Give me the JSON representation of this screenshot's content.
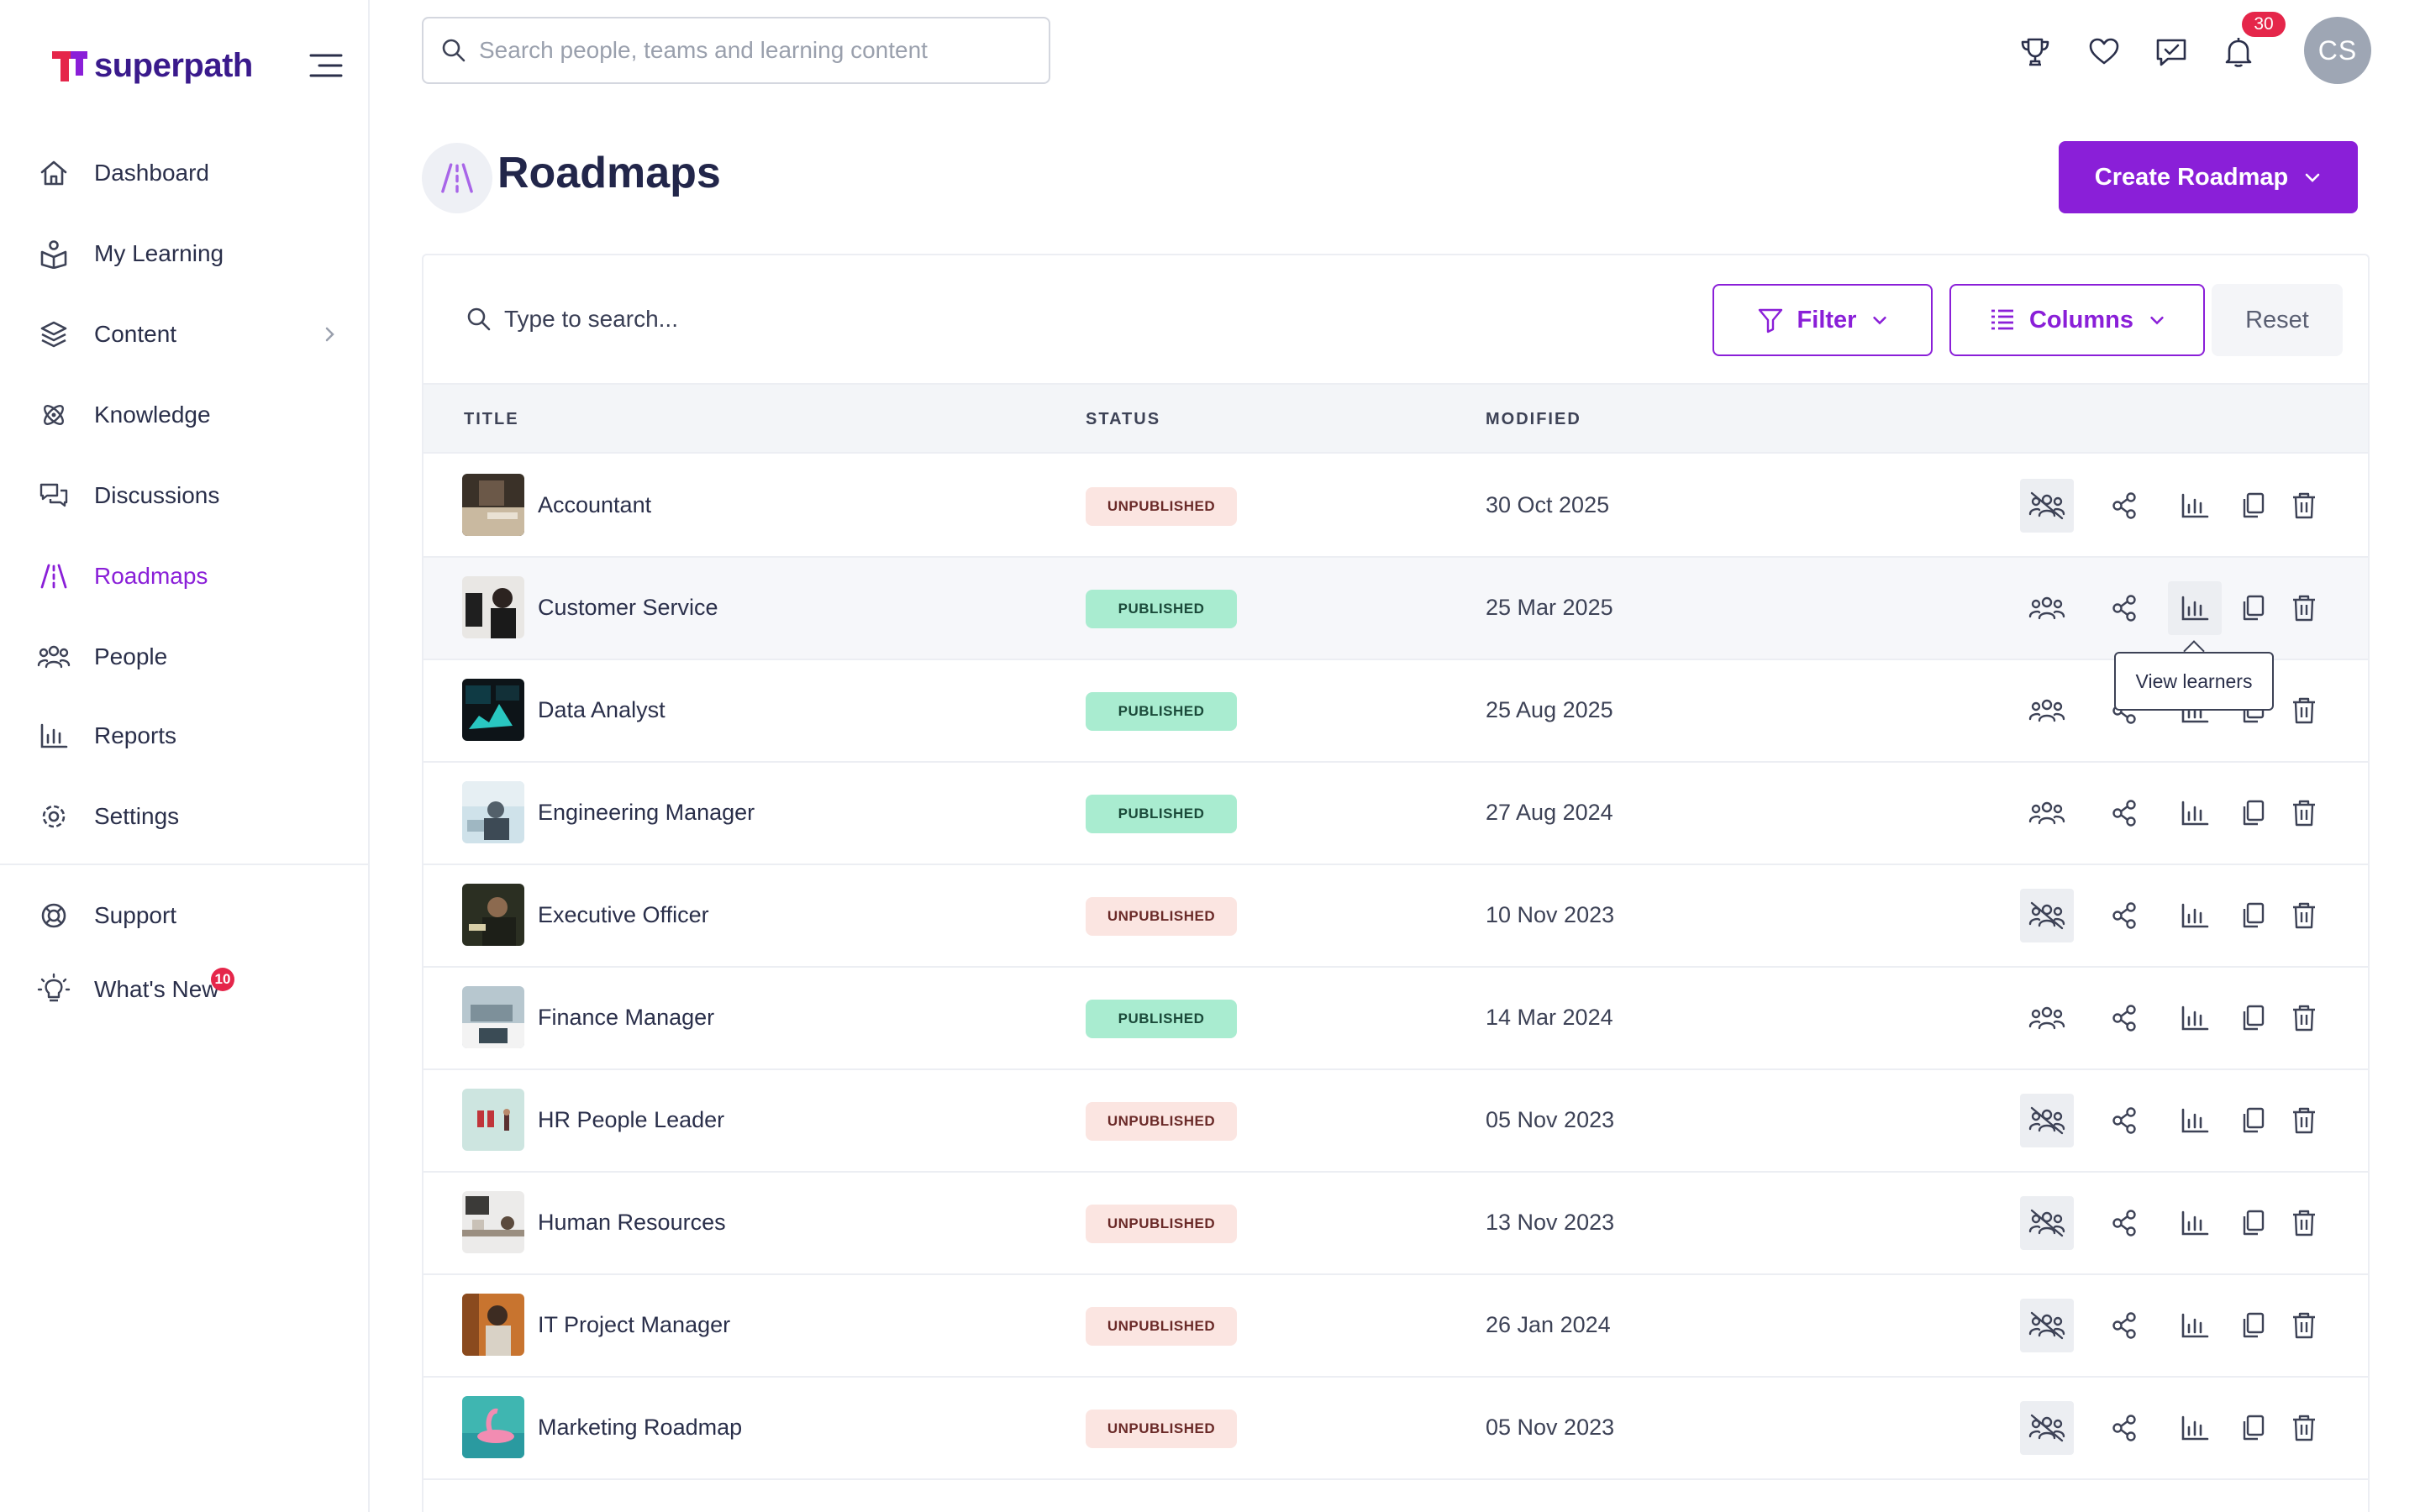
{
  "app": {
    "logo_text": "superpath"
  },
  "sidebar": {
    "items": [
      {
        "label": "Dashboard",
        "icon": "home-icon"
      },
      {
        "label": "My Learning",
        "icon": "book-person-icon"
      },
      {
        "label": "Content",
        "icon": "layers-icon"
      },
      {
        "label": "Knowledge",
        "icon": "atom-icon"
      },
      {
        "label": "Discussions",
        "icon": "chat-bubbles-icon"
      },
      {
        "label": "Roadmaps",
        "icon": "road-icon"
      },
      {
        "label": "People",
        "icon": "people-icon"
      },
      {
        "label": "Reports",
        "icon": "bar-chart-icon"
      },
      {
        "label": "Settings",
        "icon": "gear-icon"
      }
    ],
    "bottom_items": [
      {
        "label": "Support",
        "icon": "lifebuoy-icon"
      },
      {
        "label": "What's New",
        "icon": "lightbulb-icon",
        "badge": "10"
      }
    ]
  },
  "topbar": {
    "search_placeholder": "Search people, teams and learning content",
    "notification_count": "30",
    "avatar_initials": "CS"
  },
  "page": {
    "title": "Roadmaps",
    "create_button": "Create Roadmap"
  },
  "toolbar": {
    "search_placeholder": "Type to search...",
    "filter_label": "Filter",
    "columns_label": "Columns",
    "reset_label": "Reset"
  },
  "table": {
    "columns": [
      "TITLE",
      "STATUS",
      "MODIFIED"
    ],
    "rows": [
      {
        "title": "Accountant",
        "status": "UNPUBLISHED",
        "modified": "30 Oct 2025"
      },
      {
        "title": "Customer Service",
        "status": "PUBLISHED",
        "modified": "25 Mar 2025"
      },
      {
        "title": "Data Analyst",
        "status": "PUBLISHED",
        "modified": "25 Aug 2025"
      },
      {
        "title": "Engineering Manager",
        "status": "PUBLISHED",
        "modified": "27 Aug 2024"
      },
      {
        "title": "Executive Officer",
        "status": "UNPUBLISHED",
        "modified": "10 Nov 2023"
      },
      {
        "title": "Finance Manager",
        "status": "PUBLISHED",
        "modified": "14 Mar 2024"
      },
      {
        "title": "HR People Leader",
        "status": "UNPUBLISHED",
        "modified": "05 Nov 2023"
      },
      {
        "title": "Human Resources",
        "status": "UNPUBLISHED",
        "modified": "13 Nov 2023"
      },
      {
        "title": "IT Project Manager",
        "status": "UNPUBLISHED",
        "modified": "26 Jan 2024"
      },
      {
        "title": "Marketing Roadmap",
        "status": "UNPUBLISHED",
        "modified": "05 Nov 2023"
      }
    ]
  },
  "tooltip": {
    "text": "View learners"
  },
  "colors": {
    "accent": "#8a1fd8",
    "published_bg": "#a9ecd0",
    "unpublished_bg": "#fbe5e1",
    "badge": "#e5264a"
  }
}
